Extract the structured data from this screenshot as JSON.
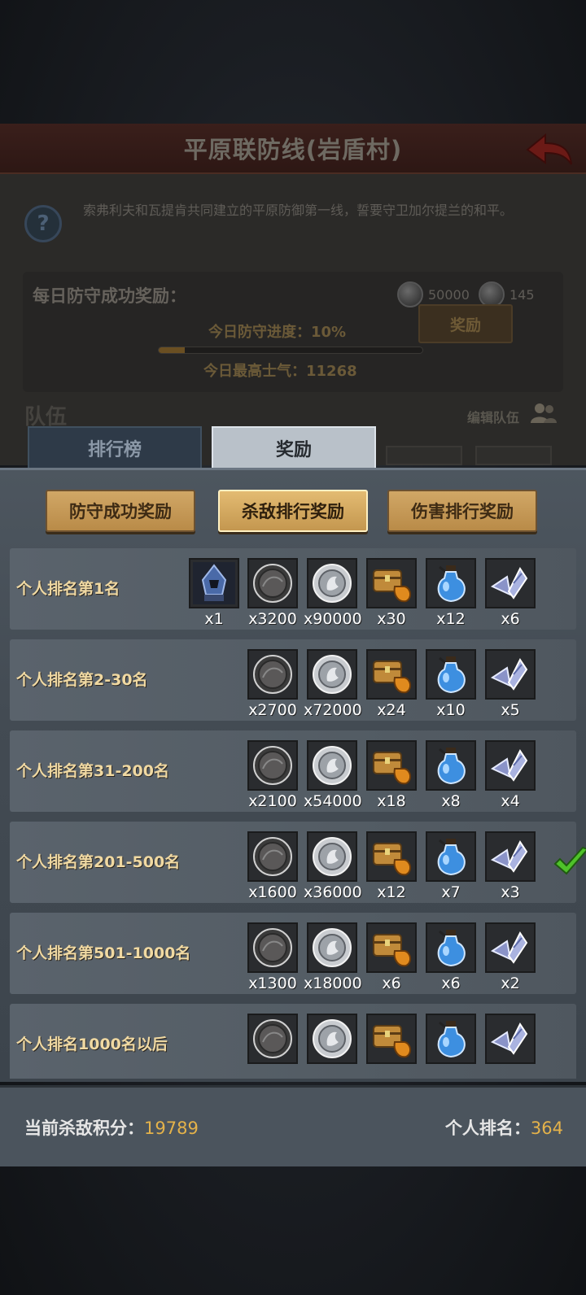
{
  "background": {
    "title": "平原联防线(岩盾村)",
    "description": "索弗利夫和瓦提肯共同建立的平原防御第一线，誓要守卫加尔提兰的和平。",
    "daily_reward_label": "每日防守成功奖励：",
    "daily_reward_coin": "50000",
    "daily_reward_other": "145",
    "progress_label": "今日防守进度：10%",
    "progress": 0.1,
    "morale_label": "今日最高士气：11268",
    "reward_button": "奖励",
    "team_label": "队伍",
    "edit_team": "编辑队伍"
  },
  "tabs": [
    {
      "label": "排行榜",
      "active": false
    },
    {
      "label": "奖励",
      "active": true
    }
  ],
  "sub_tabs": [
    {
      "label": "防守成功奖励",
      "selected": false
    },
    {
      "label": "杀敌排行奖励",
      "selected": true
    },
    {
      "label": "伤害排行奖励",
      "selected": false
    }
  ],
  "rows": [
    {
      "label": "个人排名第1名",
      "items": [
        {
          "icon": "hooded-figure-icon",
          "count": "x1"
        },
        {
          "icon": "dark-coin-icon",
          "count": "x3200"
        },
        {
          "icon": "silver-coin-icon",
          "count": "x90000"
        },
        {
          "icon": "treasure-chest-icon",
          "count": "x30"
        },
        {
          "icon": "blue-potion-icon",
          "count": "x12"
        },
        {
          "icon": "crystal-shards-icon",
          "count": "x6"
        }
      ],
      "claimed": false
    },
    {
      "label": "个人排名第2-30名",
      "items": [
        {
          "icon": "dark-coin-icon",
          "count": "x2700"
        },
        {
          "icon": "silver-coin-icon",
          "count": "x72000"
        },
        {
          "icon": "treasure-chest-icon",
          "count": "x24"
        },
        {
          "icon": "blue-potion-icon",
          "count": "x10"
        },
        {
          "icon": "crystal-shards-icon",
          "count": "x5"
        }
      ],
      "claimed": false
    },
    {
      "label": "个人排名第31-200名",
      "items": [
        {
          "icon": "dark-coin-icon",
          "count": "x2100"
        },
        {
          "icon": "silver-coin-icon",
          "count": "x54000"
        },
        {
          "icon": "treasure-chest-icon",
          "count": "x18"
        },
        {
          "icon": "blue-potion-icon",
          "count": "x8"
        },
        {
          "icon": "crystal-shards-icon",
          "count": "x4"
        }
      ],
      "claimed": false
    },
    {
      "label": "个人排名第201-500名",
      "items": [
        {
          "icon": "dark-coin-icon",
          "count": "x1600"
        },
        {
          "icon": "silver-coin-icon",
          "count": "x36000"
        },
        {
          "icon": "treasure-chest-icon",
          "count": "x12"
        },
        {
          "icon": "blue-potion-icon",
          "count": "x7"
        },
        {
          "icon": "crystal-shards-icon",
          "count": "x3"
        }
      ],
      "claimed": true
    },
    {
      "label": "个人排名第501-1000名",
      "items": [
        {
          "icon": "dark-coin-icon",
          "count": "x1300"
        },
        {
          "icon": "silver-coin-icon",
          "count": "x18000"
        },
        {
          "icon": "treasure-chest-icon",
          "count": "x6"
        },
        {
          "icon": "blue-potion-icon",
          "count": "x6"
        },
        {
          "icon": "crystal-shards-icon",
          "count": "x2"
        }
      ],
      "claimed": false
    },
    {
      "label": "个人排名1000名以后",
      "items": [
        {
          "icon": "dark-coin-icon",
          "count": ""
        },
        {
          "icon": "silver-coin-icon",
          "count": ""
        },
        {
          "icon": "treasure-chest-icon",
          "count": ""
        },
        {
          "icon": "blue-potion-icon",
          "count": ""
        },
        {
          "icon": "crystal-shards-icon",
          "count": ""
        }
      ],
      "claimed": false
    }
  ],
  "footer": {
    "score_label": "当前杀敌积分：",
    "score_value": "19789",
    "rank_label": "个人排名：",
    "rank_value": "364"
  },
  "colors": {
    "accent_gold": "#e4b24a",
    "label_gold": "#f0d9a2",
    "check_green": "#4fc22a"
  }
}
